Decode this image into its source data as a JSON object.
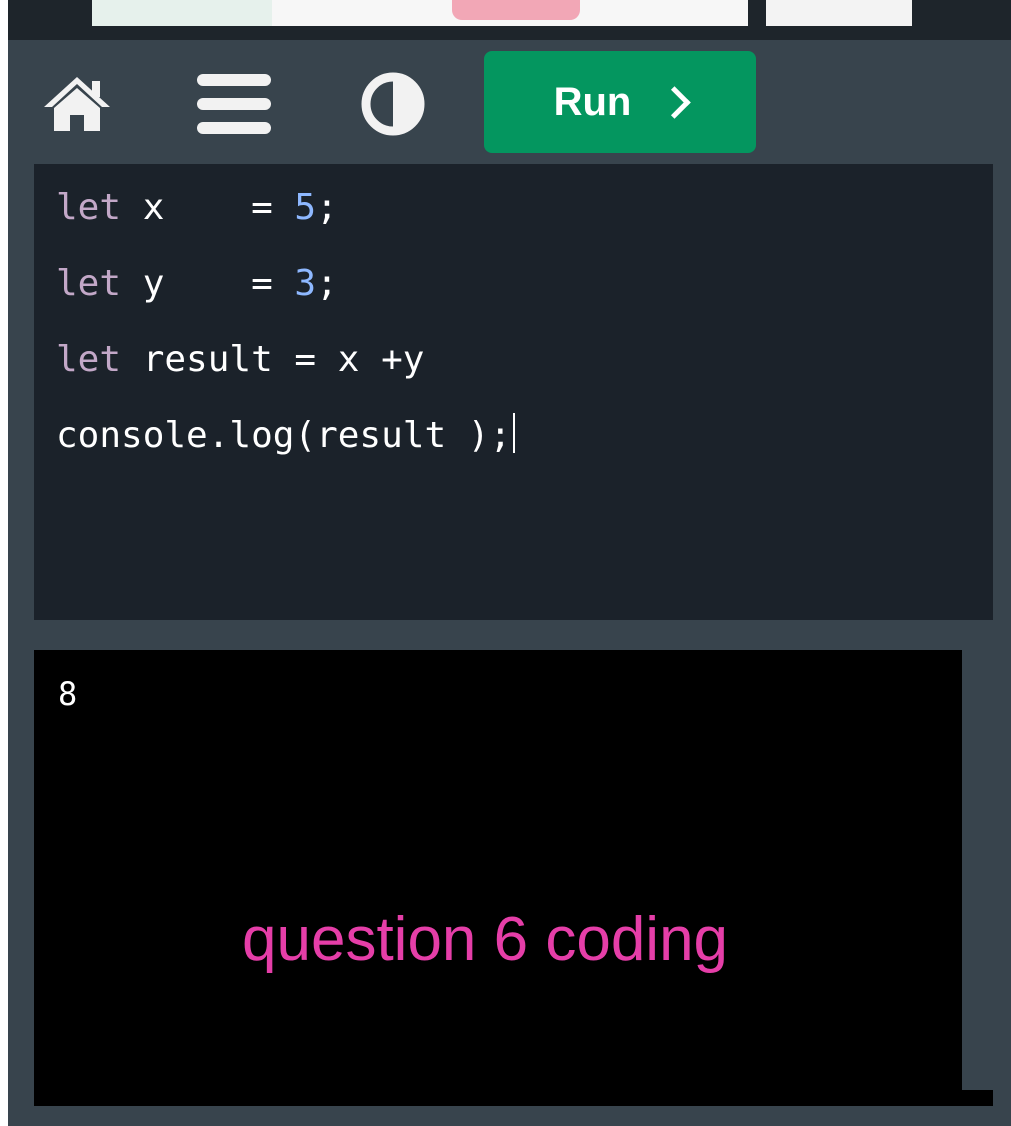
{
  "toolbar": {
    "run_label": "Run",
    "icons": [
      "home-icon",
      "menu-icon",
      "contrast-icon",
      "chevron-right-icon"
    ]
  },
  "editor": {
    "lines": [
      {
        "keyword": "let",
        "rest": " x    = ",
        "number": "5",
        "tail": ";"
      },
      {
        "keyword": "let",
        "rest": " y    = ",
        "number": "3",
        "tail": ";"
      },
      {
        "keyword": "let",
        "rest": " result = x +y",
        "number": "",
        "tail": ""
      },
      {
        "keyword": "",
        "rest": "console.log(result );",
        "number": "",
        "tail": ""
      }
    ]
  },
  "console": {
    "output": "8"
  },
  "overlay": {
    "caption": "question 6 coding"
  },
  "colors": {
    "background": "#38444d",
    "editor_bg": "#1b222a",
    "run_button": "#04965f",
    "keyword": "#c3a8c8",
    "number": "#8eb8ff",
    "caption": "#e53ea8"
  }
}
